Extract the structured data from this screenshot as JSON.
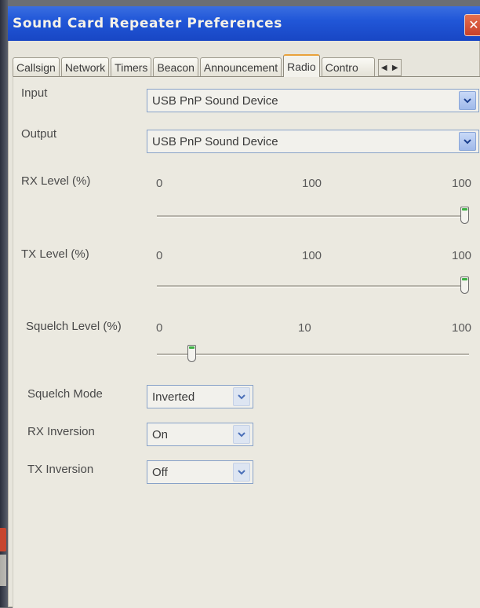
{
  "window": {
    "title": "Sound Card Repeater Preferences"
  },
  "tabs": [
    "Callsign",
    "Network",
    "Timers",
    "Beacon",
    "Announcement",
    "Radio",
    "Contro"
  ],
  "active_tab": "Radio",
  "input": {
    "label": "Input",
    "value": "USB PnP Sound Device"
  },
  "output": {
    "label": "Output",
    "value": "USB PnP Sound Device"
  },
  "rx_level": {
    "label": "RX Level (%)",
    "min": "0",
    "current": "100",
    "max": "100",
    "value": 100
  },
  "tx_level": {
    "label": "TX Level (%)",
    "min": "0",
    "current": "100",
    "max": "100",
    "value": 100
  },
  "squelch_level": {
    "label": "Squelch Level (%)",
    "min": "0",
    "current": "10",
    "max": "100",
    "value": 10
  },
  "squelch_mode": {
    "label": "Squelch Mode",
    "value": "Inverted"
  },
  "rx_inversion": {
    "label": "RX Inversion",
    "value": "On"
  },
  "tx_inversion": {
    "label": "TX Inversion",
    "value": "Off"
  },
  "colors": {
    "titlebar": "#2157d8",
    "active_tab_accent": "#e9a23b",
    "slider_thumb_accent": "#3cb043"
  }
}
